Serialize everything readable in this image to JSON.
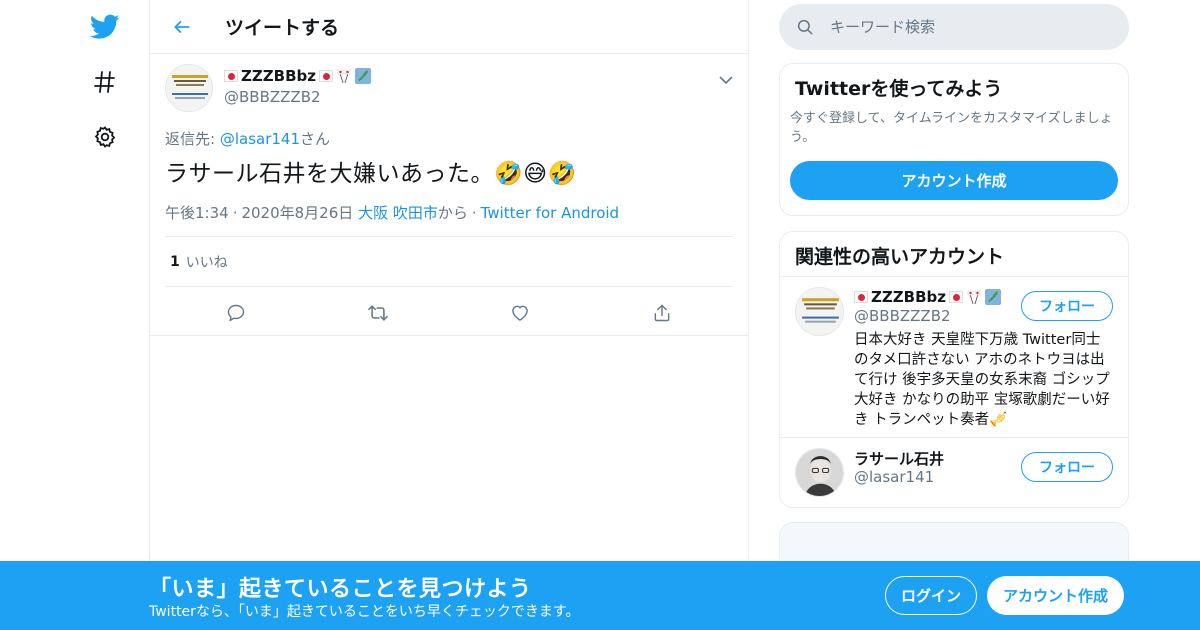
{
  "header": {
    "title": "ツイートする"
  },
  "tweet": {
    "author_name": "ZZZBBbz",
    "author_handle": "@BBBZZZB2",
    "reply_prefix": "返信先: ",
    "reply_to": "@lasar141",
    "reply_suffix": "さん",
    "text": "ラサール石井を大嫌いあった。🤣😅🤣",
    "time": "午後1:34",
    "date": "2020年8月26日",
    "location": "大阪 吹田市",
    "location_suffix": "から",
    "source": "Twitter for Android",
    "like_count": "1",
    "like_label": "いいね"
  },
  "search": {
    "placeholder": "キーワード検索"
  },
  "signup_card": {
    "title": "Twitterを使ってみよう",
    "description": "今すぐ登録して、タイムラインをカスタマイズしましょう。",
    "button_label": "アカウント作成"
  },
  "related": {
    "title": "関連性の高いアカウント",
    "users": [
      {
        "name": "ZZZBBbz",
        "handle": "@BBBZZZB2",
        "bio": "日本大好き 天皇陛下万歳 Twitter同士のタメ口許さない アホのネトウヨは出て行け 後宇多天皇の女系末裔 ゴシップ大好き かなりの助平 宝塚歌劇だーい好き トランペット奏者🎺",
        "follow_label": "フォロー"
      },
      {
        "name": "ラサール石井",
        "handle": "@lasar141",
        "follow_label": "フォロー"
      }
    ]
  },
  "bottom_bar": {
    "title": "「いま」起きていることを見つけよう",
    "subtitle": "Twitterなら、「いま」起きていることをいち早くチェックできます。",
    "login_label": "ログイン",
    "signup_label": "アカウント作成"
  },
  "colors": {
    "accent": "#1da1f2",
    "link": "#1b95e0",
    "muted": "#657786",
    "border": "#e6ecf0"
  }
}
